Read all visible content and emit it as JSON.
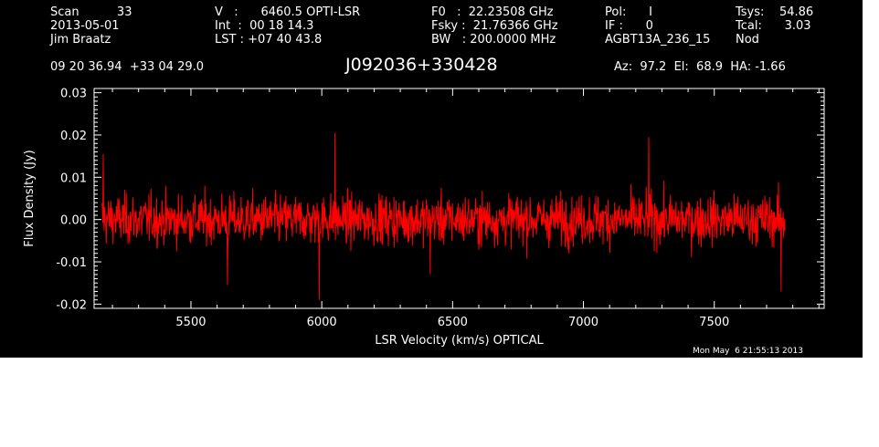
{
  "header": {
    "col1": [
      "Scan          33",
      "2013-05-01",
      "Jim Braatz"
    ],
    "col2": [
      "V   :      6460.5 OPTI-LSR",
      "Int  :  00 18 14.3",
      "LST : +07 40 43.8"
    ],
    "col3": [
      "F0   :  22.23508 GHz",
      "Fsky :  21.76366 GHz",
      "BW   : 200.0000 MHz"
    ],
    "col4": [
      "Pol:      I",
      "IF :      0",
      "AGBT13A_236_15"
    ],
    "col5": [
      "Tsys:    54.86",
      "Tcal:      3.03",
      "Nod"
    ],
    "coords": "09 20 36.94  +33 04 29.0",
    "source": "J092036+330428",
    "azelha": "Az:  97.2  El:  68.9  HA: -1.66",
    "timestamp": "Mon May  6 21:55:13 2013"
  },
  "chart_data": {
    "type": "line",
    "xlabel": "LSR Velocity (km/s) OPTICAL",
    "ylabel": "Flux Density (Jy)",
    "xlim": [
      5130,
      7920
    ],
    "ylim": [
      -0.021,
      0.031
    ],
    "xticks": [
      5500,
      6000,
      6500,
      7000,
      7500
    ],
    "xtick_labels": [
      "5500",
      "6000",
      "6500",
      "7000",
      "7500"
    ],
    "yticks": [
      -0.02,
      -0.01,
      0.0,
      0.01,
      0.02,
      0.03
    ],
    "ytick_labels": [
      "-0.02",
      "-0.01",
      "0.00",
      "0.01",
      "0.02",
      "0.03"
    ],
    "grid": false,
    "series": [
      {
        "color": "#ff0000",
        "x_start": 5160,
        "x_end": 7770,
        "noise_rms": 0.0055,
        "peaks": [
          {
            "x": 5165,
            "y": 0.0155
          },
          {
            "x": 6050,
            "y": 0.0205
          },
          {
            "x": 7250,
            "y": 0.0195
          },
          {
            "x": 5990,
            "y": -0.019
          },
          {
            "x": 7755,
            "y": -0.017
          },
          {
            "x": 5640,
            "y": -0.0155
          },
          {
            "x": 6415,
            "y": -0.013
          }
        ]
      }
    ]
  }
}
